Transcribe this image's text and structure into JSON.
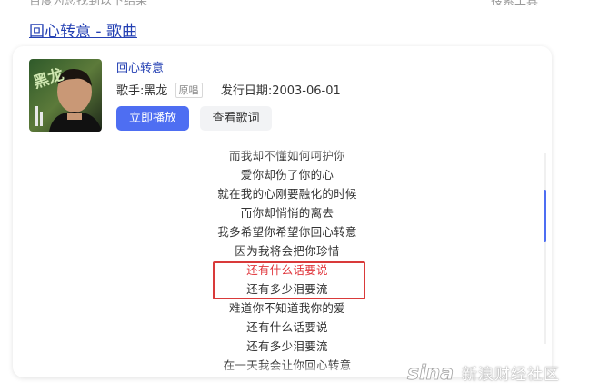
{
  "top_bar": {
    "left_text": "百度为您找到以下结果",
    "right_text": "搜索工具"
  },
  "result": {
    "title": "回心转意 - 歌曲"
  },
  "song": {
    "name": "回心转意",
    "singer_label": "歌手:",
    "singer": "黑龙",
    "tag": "原唱",
    "release_label": "发行日期:",
    "release_date": "2003-06-01",
    "play_button": "立即播放",
    "lyrics_button": "查看歌词",
    "album_art_text": "黑龙"
  },
  "lyrics": {
    "lines": [
      "而我却不懂如何呵护你",
      "爱你却伤了你的心",
      "就在我的心刚要融化的时候",
      "而你却悄悄的离去",
      "我多希望你希望你回心转意",
      "因为我将会把你珍惜",
      "还有什么话要说",
      "还有多少泪要流",
      "难道你不知道我你的爱",
      "还有什么话要说",
      "还有多少泪要流",
      "在一天我会让你回心转意"
    ],
    "active_index": 6
  },
  "colors": {
    "link": "#2440b3",
    "primary": "#4e6ef2",
    "active_lyric": "#e0383e",
    "highlight_box": "#d93a3a"
  },
  "watermark": {
    "brand_text": "新浪财经社区",
    "logo_text": "sina"
  }
}
